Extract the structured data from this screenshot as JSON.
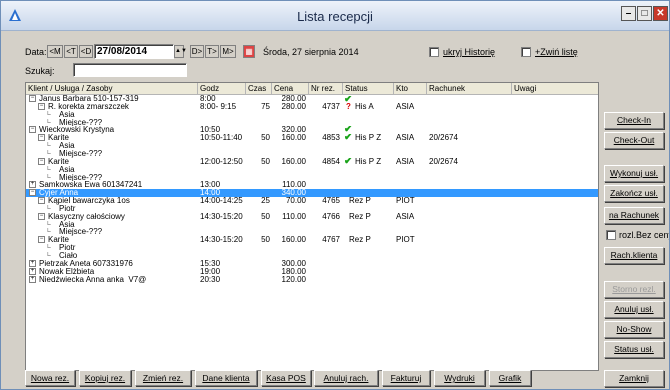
{
  "window": {
    "title": "Lista recepcji",
    "minimize": "–",
    "maximize": "□",
    "close": "✕"
  },
  "toolbar": {
    "date_label": "Data:",
    "nav_back": [
      "<M",
      "<T",
      "<D"
    ],
    "date_value": "27/08/2014",
    "nav_fwd": [
      "D>",
      "T>",
      "M>"
    ],
    "date_text": "Środa, 27 sierpnia 2014",
    "hide_history": "ukryj Historię",
    "collapse_list": "+Zwiń listę",
    "search_label": "Szukaj:",
    "search_value": ""
  },
  "columns": [
    "Klient / Usługa / Zasoby",
    "Godz",
    "Czas",
    "Cena",
    "Nr rez.",
    "Status",
    "Kto",
    "Rachunek",
    "Uwagi"
  ],
  "rows": [
    {
      "name": "Janus Barbara 510-157-319",
      "exp": "−",
      "godz": "8:00",
      "cena": "280.00"
    },
    {
      "name": "R. korekta zmarszczek",
      "exp": "−",
      "godz": "8:00- 9:15",
      "czas": "75",
      "cena": "280.00",
      "nr": "4737",
      "status": "His A",
      "icon": "both",
      "kto": "ASIA"
    },
    {
      "name": "Asia"
    },
    {
      "name": "Miejsce-???"
    },
    {
      "name": "Wieckowski Krystyna",
      "exp": "−",
      "godz": "10:50",
      "cena": "320.00",
      "icon": "check"
    },
    {
      "name": "Karite",
      "exp": "−",
      "godz": "10:50-11:40",
      "czas": "50",
      "cena": "160.00",
      "nr": "4853",
      "status": "His P Z",
      "icon": "check",
      "kto": "ASIA",
      "rach": "20/2674"
    },
    {
      "name": "Asia"
    },
    {
      "name": "Miejsce-???"
    },
    {
      "name": "Karite",
      "exp": "−",
      "godz": "12:00-12:50",
      "czas": "50",
      "cena": "160.00",
      "nr": "4854",
      "status": "His P Z",
      "icon": "check",
      "kto": "ASIA",
      "rach": "20/2674"
    },
    {
      "name": "Asia"
    },
    {
      "name": "Miejsce-???"
    },
    {
      "name": "Samkowska Ewa 601347241",
      "exp": "+",
      "godz": "13:00",
      "cena": "110.00"
    },
    {
      "name": "Cyjer Anna",
      "exp": "−",
      "godz": "14:00",
      "cena": "340.00",
      "sel": true
    },
    {
      "name": "Kąpiel bawarczyka 1os",
      "exp": "−",
      "godz": "14:00-14:25",
      "czas": "25",
      "cena": "70.00",
      "nr": "4765",
      "status": "Rez P",
      "kto": "PIOT"
    },
    {
      "name": "Piotr"
    },
    {
      "name": "Klasyczny całościowy",
      "exp": "−",
      "godz": "14:30-15:20",
      "czas": "50",
      "cena": "110.00",
      "nr": "4766",
      "status": "Rez P",
      "kto": "ASIA"
    },
    {
      "name": "Asia"
    },
    {
      "name": "Miejsce-???"
    },
    {
      "name": "Karite",
      "exp": "−",
      "godz": "14:30-15:20",
      "czas": "50",
      "cena": "160.00",
      "nr": "4767",
      "status": "Rez P",
      "kto": "PIOT"
    },
    {
      "name": "Piotr"
    },
    {
      "name": "Ciało"
    },
    {
      "name": "Pietrzak Aneta 607331976",
      "exp": "+",
      "godz": "15:30",
      "cena": "300.00"
    },
    {
      "name": "Nowak Elżbieta",
      "exp": "+",
      "godz": "19:00",
      "cena": "180.00"
    },
    {
      "name": "Niedźwiecka Anna anka_V7@",
      "exp": "+",
      "godz": "20:30",
      "cena": "120.00"
    }
  ],
  "side_buttons": [
    "Check-In",
    "Check-Out",
    "Wykonuj usł.",
    "Zakończ usł.",
    "na Rachunek",
    "rozl.Bez ceny",
    "Rach.klienta",
    "Storno rezl.",
    "Anuluj usł.",
    "No-Show",
    "Status usł."
  ],
  "bottom_buttons": [
    "Nowa rez.",
    "Kopiuj rez.",
    "Zmień rez.",
    "Dane klienta",
    "Kasa POS",
    "Anuluj rach.",
    "Fakturuj",
    "Wydruki",
    "Grafik"
  ],
  "close_button": "Zamknij",
  "colors": {
    "selection": "#3399ff",
    "check": "#1aa31a",
    "question": "#d40000"
  }
}
